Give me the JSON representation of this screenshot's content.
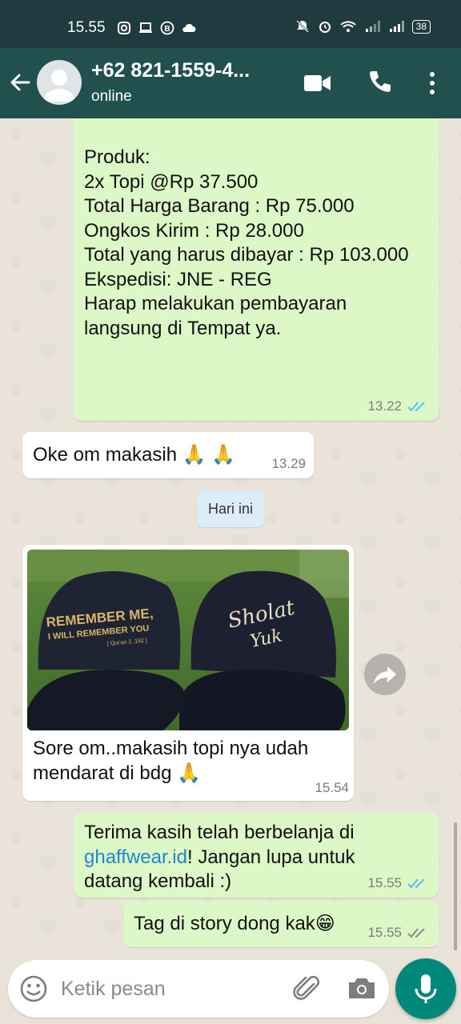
{
  "status_bar": {
    "time": "15.55",
    "battery": "38"
  },
  "header": {
    "contact_name": "+62 821-1559-4...",
    "status": "online"
  },
  "messages": {
    "invoice": {
      "lines": [
        "Produk:",
        "2x Topi @Rp 37.500",
        "",
        "Total Harga Barang : Rp 75.000",
        "Ongkos Kirim : Rp 28.000",
        "Total yang harus dibayar : Rp 103.000",
        "",
        "Ekspedisi: JNE - REG",
        "",
        "Harap melakukan pembayaran",
        "langsung di Tempat ya."
      ],
      "time": "13.22",
      "status": "read"
    },
    "oke": {
      "text": "Oke om makasih 🙏 🙏",
      "time": "13.29"
    },
    "date_separator": "Hari ini",
    "photo": {
      "cap_left_lines": [
        "REMEMBER ME,",
        "I WILL REMEMBER YOU",
        "[ Qur'an 2 ,152 ]"
      ],
      "cap_right_lines": [
        "Sholat",
        "Yuk"
      ],
      "caption_lines": [
        "Sore om..makasih topi nya udah",
        "mendarat di bdg 🙏"
      ],
      "time": "15.54"
    },
    "thanks": {
      "line1": "Terima kasih telah berbelanja di",
      "link": "ghaffwear.id",
      "line2_rest": "! Jangan lupa untuk",
      "line3": "datang kembali :)",
      "time": "15.55",
      "status": "read"
    },
    "tag": {
      "text": "Tag di story dong kak😁",
      "time": "15.55",
      "status": "delivered"
    }
  },
  "input": {
    "placeholder": "Ketik pesan"
  },
  "colors": {
    "header": "#22504e",
    "status_bar": "#1f3b40",
    "outgoing_bubble": "#dcf8c6",
    "incoming_bubble": "#ffffff",
    "read_ticks": "#4fc3f7",
    "link": "#1e88c8",
    "mic_button": "#00897b"
  },
  "icons": [
    "back-arrow-icon",
    "video-call-icon",
    "phone-icon",
    "more-vert-icon",
    "emoji-icon",
    "paperclip-icon",
    "camera-icon",
    "mic-icon",
    "forward-icon",
    "double-check-icon"
  ]
}
